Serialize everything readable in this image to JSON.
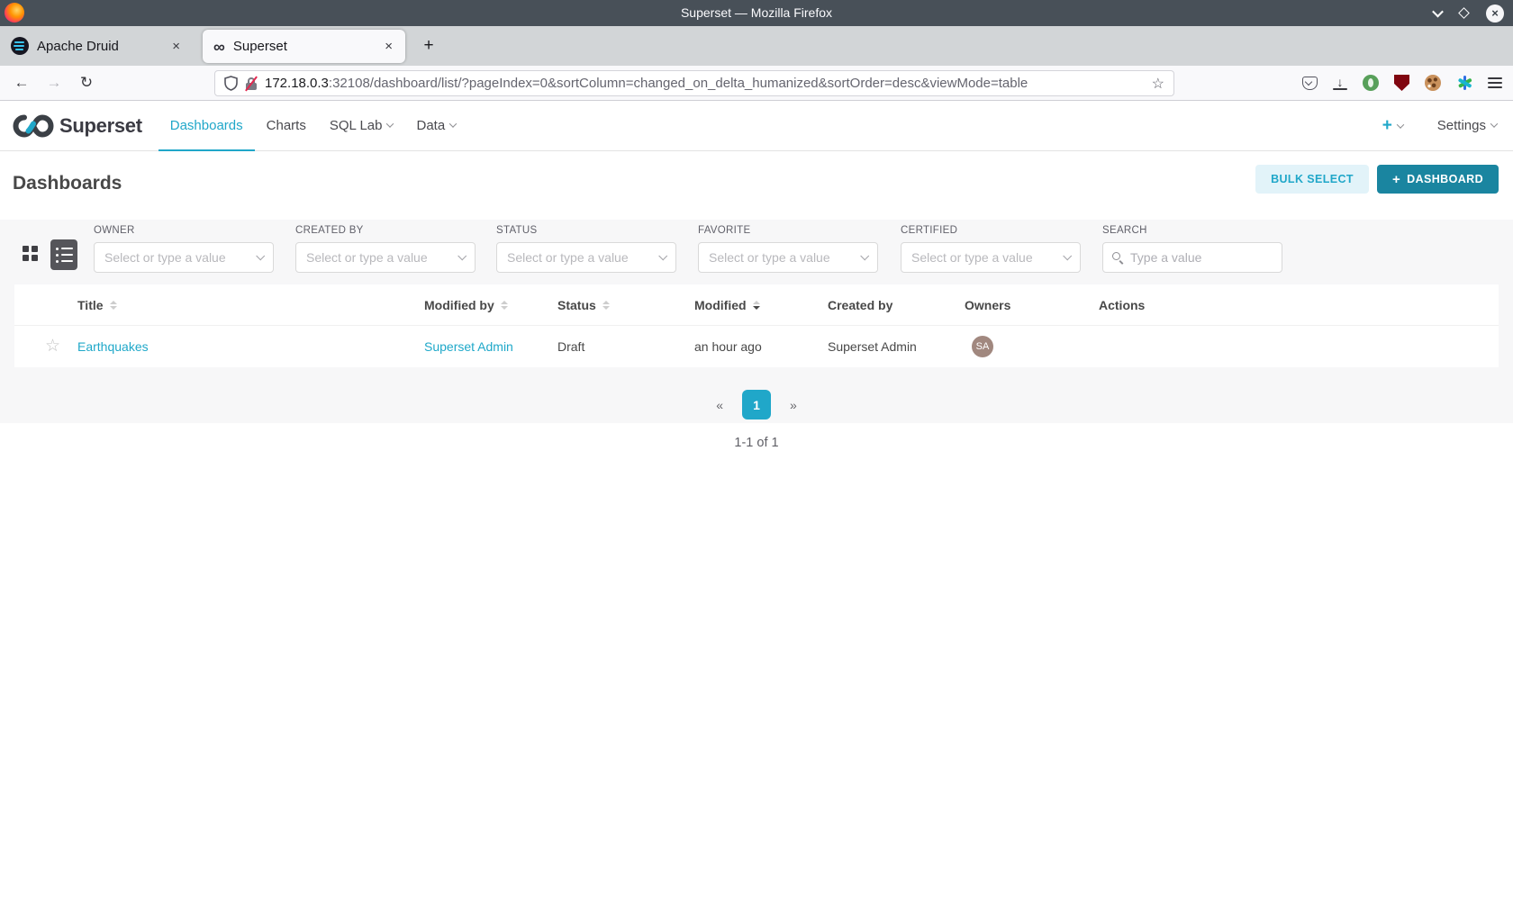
{
  "window": {
    "title": "Superset — Mozilla Firefox"
  },
  "tabs": [
    {
      "label": "Apache Druid",
      "active": false
    },
    {
      "label": "Superset",
      "active": true
    }
  ],
  "url": {
    "domain": "172.18.0.3",
    "rest": ":32108/dashboard/list/?pageIndex=0&sortColumn=changed_on_delta_humanized&sortOrder=desc&viewMode=table"
  },
  "icons": {
    "close": "×",
    "new_tab": "+",
    "back": "←",
    "forward": "→",
    "reload": "↻",
    "bookmark_star": "☆",
    "favorite_star": "☆",
    "prev": "«",
    "next": "»"
  },
  "navbar": {
    "brand": "Superset",
    "items": [
      {
        "label": "Dashboards",
        "active": true
      },
      {
        "label": "Charts",
        "active": false
      },
      {
        "label": "SQL Lab",
        "active": false,
        "dropdown": true
      },
      {
        "label": "Data",
        "active": false,
        "dropdown": true
      }
    ],
    "plus_label": "+",
    "settings_label": "Settings"
  },
  "page": {
    "title": "Dashboards",
    "bulk_select_label": "BULK SELECT",
    "new_dashboard_label": "DASHBOARD"
  },
  "filters": [
    {
      "label": "OWNER",
      "placeholder": "Select or type a value"
    },
    {
      "label": "CREATED BY",
      "placeholder": "Select or type a value"
    },
    {
      "label": "STATUS",
      "placeholder": "Select or type a value"
    },
    {
      "label": "FAVORITE",
      "placeholder": "Select or type a value"
    },
    {
      "label": "CERTIFIED",
      "placeholder": "Select or type a value"
    },
    {
      "label": "SEARCH",
      "placeholder": "Type a value"
    }
  ],
  "table": {
    "columns": [
      {
        "label": "Title",
        "sort": "both"
      },
      {
        "label": "Modified by",
        "sort": "both"
      },
      {
        "label": "Status",
        "sort": "both"
      },
      {
        "label": "Modified",
        "sort": "desc"
      },
      {
        "label": "Created by",
        "sort": "none"
      },
      {
        "label": "Owners",
        "sort": "none"
      },
      {
        "label": "Actions",
        "sort": "none"
      }
    ],
    "rows": [
      {
        "title": "Earthquakes",
        "modified_by": "Superset Admin",
        "status": "Draft",
        "modified": "an hour ago",
        "created_by": "Superset Admin",
        "owner_initials": "SA"
      }
    ]
  },
  "pagination": {
    "prev": "«",
    "active_page": "1",
    "next": "»",
    "summary": "1-1 of 1"
  },
  "colors": {
    "primary": "#20A7C9",
    "primary_dark": "#1A85A0",
    "avatar": "#A1887F",
    "titlebar": "#485058"
  }
}
